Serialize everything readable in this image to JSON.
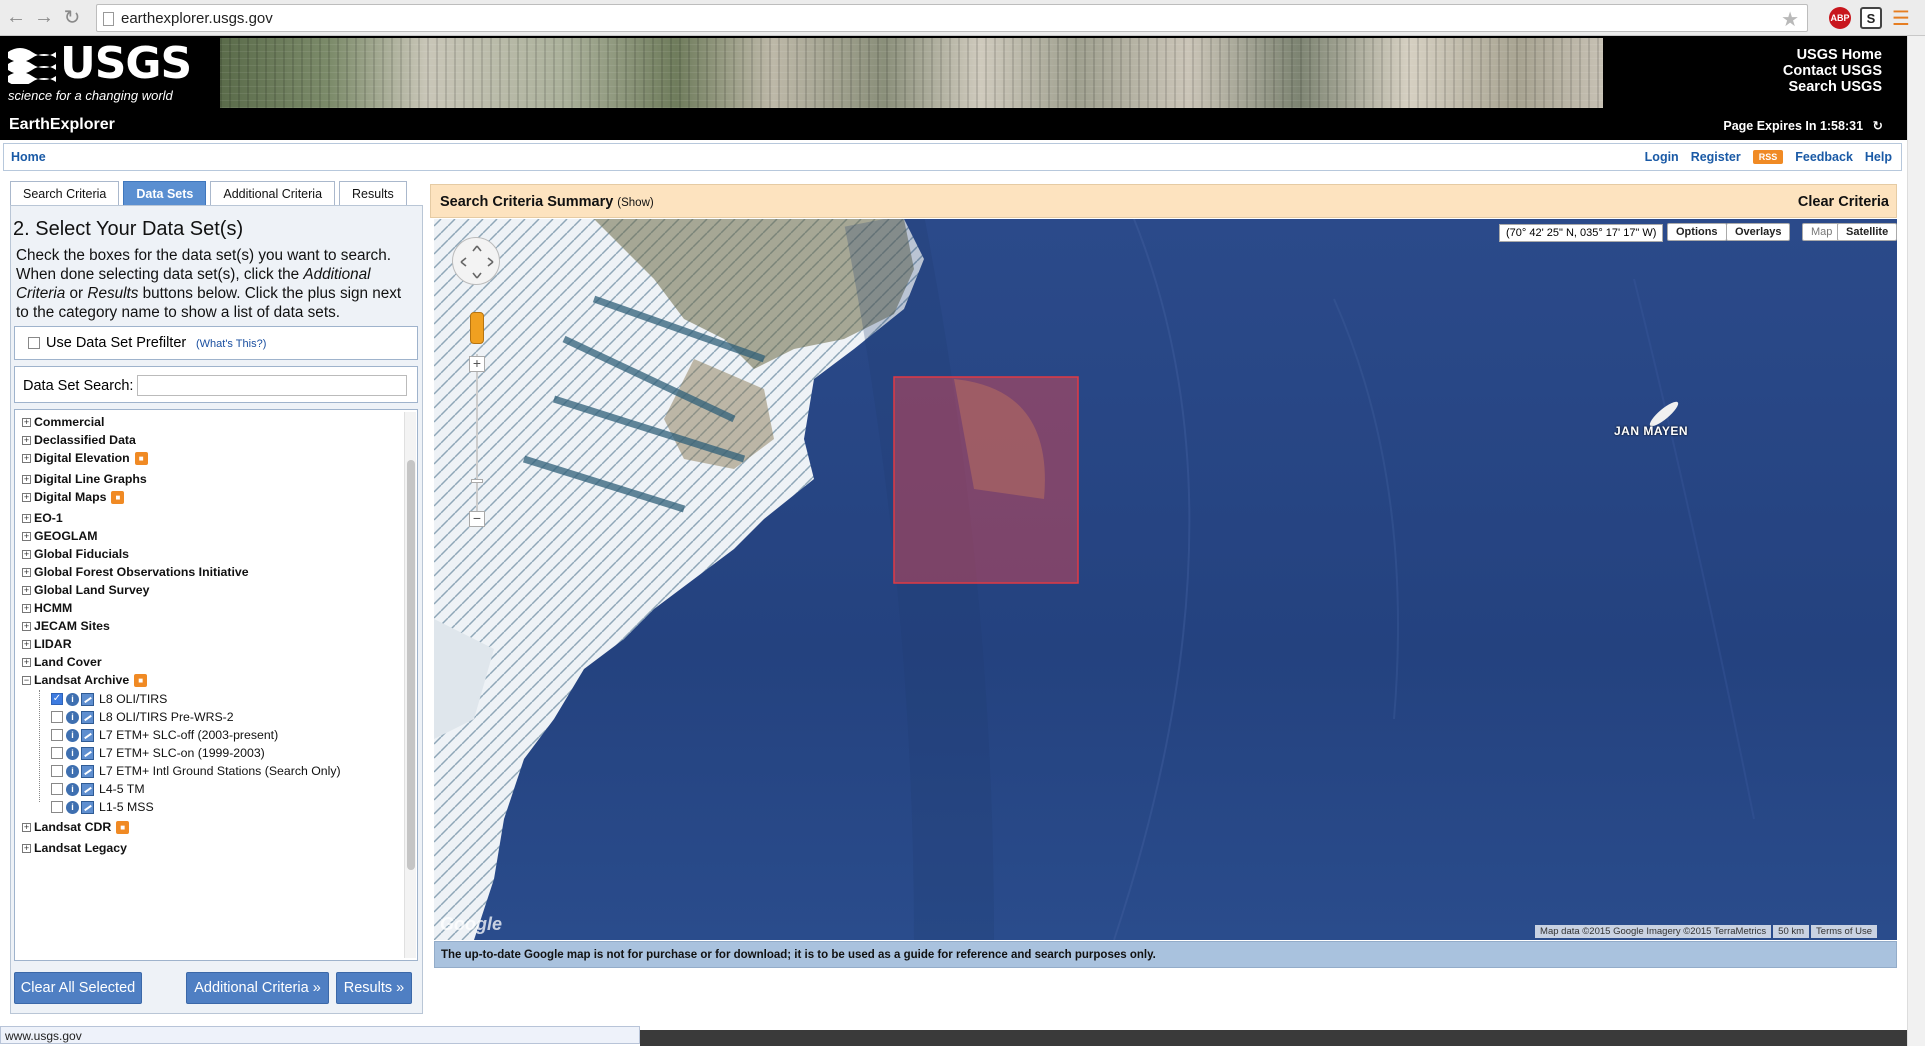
{
  "browser": {
    "url": "earthexplorer.usgs.gov",
    "ext_abp": "ABP",
    "ext_s": "S"
  },
  "header": {
    "logo_text": "USGS",
    "tagline": "science for a changing world",
    "links": [
      "USGS Home",
      "Contact USGS",
      "Search USGS"
    ]
  },
  "appbar": {
    "title": "EarthExplorer",
    "expires": "Page Expires In 1:58:31"
  },
  "navbar": {
    "home": "Home",
    "login": "Login",
    "register": "Register",
    "rss": "RSS",
    "feedback": "Feedback",
    "help": "Help"
  },
  "tabs": [
    {
      "label": "Search Criteria",
      "active": false
    },
    {
      "label": "Data Sets",
      "active": true
    },
    {
      "label": "Additional Criteria",
      "active": false
    },
    {
      "label": "Results",
      "active": false
    }
  ],
  "left": {
    "title": "2. Select Your Data Set(s)",
    "desc_1": "Check the boxes for the data set(s) you want to search. When done selecting data set(s), click the ",
    "desc_additional": "Additional Criteria",
    "desc_2": " or ",
    "desc_results": "Results",
    "desc_3": " buttons below. Click the plus sign next to the category name to show a list of data sets.",
    "prefilter_label": "Use Data Set Prefilter",
    "whats_this": "(What's This?)",
    "search_label": "Data Set Search:",
    "search_value": "",
    "categories": [
      {
        "label": "Commercial",
        "badge": false
      },
      {
        "label": "Declassified Data",
        "badge": false
      },
      {
        "label": "Digital Elevation",
        "badge": true
      },
      {
        "label": "Digital Line Graphs",
        "badge": false
      },
      {
        "label": "Digital Maps",
        "badge": true
      },
      {
        "label": "EO-1",
        "badge": false
      },
      {
        "label": "GEOGLAM",
        "badge": false
      },
      {
        "label": "Global Fiducials",
        "badge": false
      },
      {
        "label": "Global Forest Observations Initiative",
        "badge": false
      },
      {
        "label": "Global Land Survey",
        "badge": false
      },
      {
        "label": "HCMM",
        "badge": false
      },
      {
        "label": "JECAM Sites",
        "badge": false
      },
      {
        "label": "LIDAR",
        "badge": false
      },
      {
        "label": "Land Cover",
        "badge": false
      },
      {
        "label": "Landsat Archive",
        "badge": true
      }
    ],
    "landsat_children": [
      {
        "label": "L8 OLI/TIRS",
        "checked": true
      },
      {
        "label": "L8 OLI/TIRS Pre-WRS-2",
        "checked": false
      },
      {
        "label": "L7 ETM+ SLC-off (2003-present)",
        "checked": false
      },
      {
        "label": "L7 ETM+ SLC-on (1999-2003)",
        "checked": false
      },
      {
        "label": "L7 ETM+ Intl Ground Stations (Search Only)",
        "checked": false
      },
      {
        "label": "L4-5 TM",
        "checked": false
      },
      {
        "label": "L1-5 MSS",
        "checked": false
      }
    ],
    "after_categories": [
      {
        "label": "Landsat CDR",
        "badge": true
      },
      {
        "label": "Landsat Legacy",
        "badge": false
      }
    ],
    "buttons": {
      "clear": "Clear All Selected",
      "additional": "Additional Criteria »",
      "results": "Results »"
    }
  },
  "summary": {
    "title": "Search Criteria Summary",
    "show": "(Show)",
    "clear": "Clear Criteria"
  },
  "map": {
    "coord": "(70° 42' 25\" N, 035° 17' 17\" W)",
    "options": "Options",
    "overlays": "Overlays",
    "map_btn": "Map",
    "satellite_btn": "Satellite",
    "place_label": "JAN MAYEN",
    "google": "Google",
    "footer_data": "Map data ©2015 Google Imagery ©2015 TerraMetrics",
    "footer_scale": "50 km",
    "footer_terms": "Terms of Use",
    "disclaimer": "The up-to-date Google map is not for purchase or for download; it is to be used as a guide for reference and search purposes only.",
    "colors": {
      "ocean": "#2b4a8a",
      "footprint": "#e8474f"
    }
  },
  "status": {
    "text": "www.usgs.gov"
  }
}
